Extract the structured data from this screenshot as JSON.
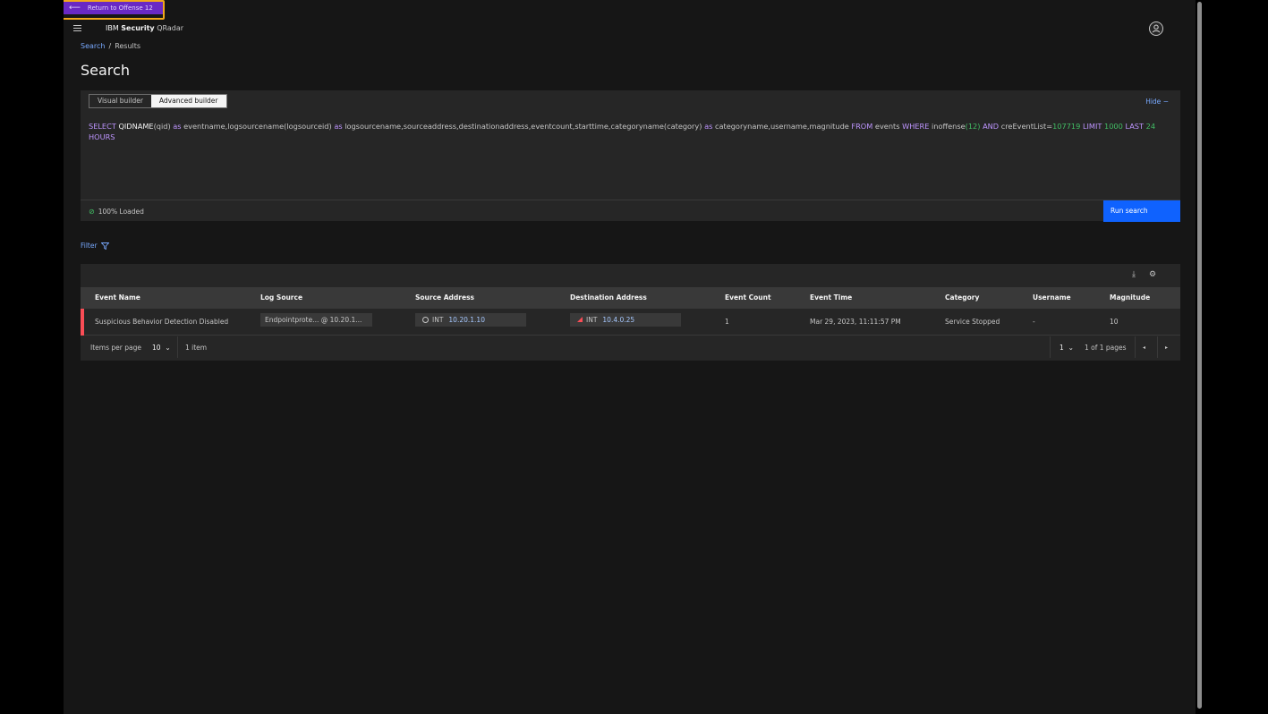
{
  "return_button": {
    "label": "Return to Offense 12",
    "icon": "arrow-left-icon"
  },
  "header": {
    "brand_bold": "Security",
    "brand_prefix": "IBM",
    "product": "QRadar",
    "user_icon": "user-avatar-icon"
  },
  "breadcrumb": {
    "root": "Search",
    "separator": "/",
    "current": "Results"
  },
  "page_title": "Search",
  "query_panel": {
    "visual_builder": "Visual builder",
    "advanced_builder": "Advanced builder",
    "hide_label": "Hide",
    "hide_icon": "−",
    "query": [
      {
        "t": "SELECT ",
        "c": "kw"
      },
      {
        "t": "QIDNAME",
        "c": "fn"
      },
      {
        "t": "(qid) ",
        "c": "plain"
      },
      {
        "t": "as ",
        "c": "kw"
      },
      {
        "t": "eventname,logsourcename(logsourceid) ",
        "c": "plain"
      },
      {
        "t": "as ",
        "c": "kw"
      },
      {
        "t": "logsourcename,sourceaddress,destinationaddress,eventcount,starttime,categoryname(category) ",
        "c": "plain"
      },
      {
        "t": "as ",
        "c": "kw"
      },
      {
        "t": "categoryname,username,magnitude ",
        "c": "plain"
      },
      {
        "t": "FROM ",
        "c": "kw"
      },
      {
        "t": "events ",
        "c": "plain"
      },
      {
        "t": "WHERE ",
        "c": "kw"
      },
      {
        "t": "inoffense",
        "c": "plain"
      },
      {
        "t": "(12) ",
        "c": "num"
      },
      {
        "t": "AND ",
        "c": "kw"
      },
      {
        "t": "creEventList=",
        "c": "plain"
      },
      {
        "t": "107719 ",
        "c": "num"
      },
      {
        "t": "LIMIT ",
        "c": "kw"
      },
      {
        "t": "1000 ",
        "c": "num"
      },
      {
        "t": "LAST ",
        "c": "kw"
      },
      {
        "t": "24 ",
        "c": "num"
      },
      {
        "t": "HOURS",
        "c": "kw"
      }
    ],
    "status": "100% Loaded",
    "run_label": "Run search"
  },
  "filter_label": "Filter",
  "table": {
    "columns": [
      "Event Name",
      "Log Source",
      "Source Address",
      "Destination Address",
      "Event Count",
      "Event Time",
      "Category",
      "Username",
      "Magnitude"
    ],
    "rows": [
      {
        "event_name": "Suspicious Behavior Detection Disabled",
        "log_source": "Endpointprote... @ 10.20.1...",
        "source_tag": "INT",
        "source_ip": "10.20.1.10",
        "dest_tag": "INT",
        "dest_ip": "10.4.0.25",
        "event_count": "1",
        "event_time": "Mar 29, 2023, 11:11:57 PM",
        "category": "Service Stopped",
        "username": "-",
        "magnitude": "10",
        "severity_color": "#fa4d56"
      }
    ],
    "pager": {
      "items_per_page_label": "Items per page",
      "items_per_page": "10",
      "item_count": "1 item",
      "page": "1",
      "page_of": "1 of 1 pages"
    }
  },
  "colors": {
    "accent": "#0f62fe",
    "return": "#6929c4",
    "highlight": "#f1a81a",
    "link": "#78a9ff"
  }
}
